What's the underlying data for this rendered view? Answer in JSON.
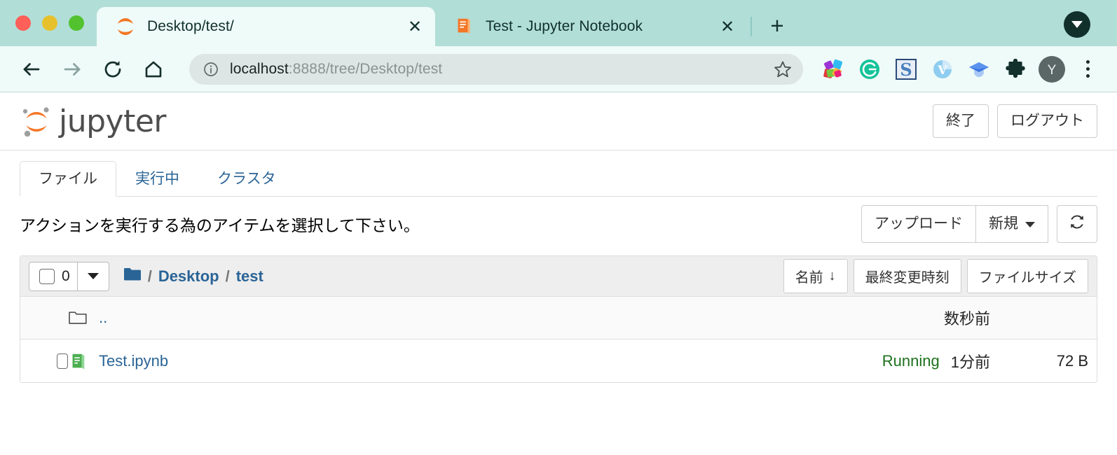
{
  "browser": {
    "tabs": [
      {
        "title": "Desktop/test/",
        "favicon": "jupyter-loading-icon",
        "active": true,
        "close_label": "✕"
      },
      {
        "title": "Test - Jupyter Notebook",
        "favicon": "notebook-orange-icon",
        "active": false,
        "close_label": "✕"
      }
    ],
    "new_tab_label": "+",
    "nav": {
      "back": "back-arrow-icon",
      "forward": "forward-arrow-icon",
      "reload": "reload-icon",
      "home": "home-icon"
    },
    "omnibox": {
      "info_icon": "info-circle-icon",
      "url_host": "localhost",
      "url_rest": ":8888/tree/Desktop/test",
      "url_full": "localhost:8888/tree/Desktop/test",
      "bookmark_icon": "star-outline-icon"
    },
    "extensions": [
      "colorful-pinwheel-extension-icon",
      "grammarly-extension-icon",
      "s-blue-extension-icon",
      "v-blue-extension-icon",
      "graduation-cap-extension-icon",
      "puzzle-extensions-icon"
    ],
    "profile_initial": "Y",
    "menu_icon": "kebab-menu-icon",
    "tab_search_icon": "tab-search-caret-icon"
  },
  "jupyter": {
    "logo_text": "jupyter",
    "header_buttons": [
      {
        "label": "終了",
        "name": "quit-button"
      },
      {
        "label": "ログアウト",
        "name": "logout-button"
      }
    ],
    "tabs": [
      {
        "label": "ファイル",
        "active": true
      },
      {
        "label": "実行中",
        "active": false
      },
      {
        "label": "クラスタ",
        "active": false
      }
    ],
    "action_text": "アクションを実行する為のアイテムを選択して下さい。",
    "upload_label": "アップロード",
    "new_label": "新規",
    "refresh_icon": "refresh-icon",
    "selection": {
      "count": "0",
      "checkbox_icon": "checkbox-unchecked-icon",
      "caret_icon": "chevron-down-icon"
    },
    "breadcrumb": {
      "folder_icon": "folder-blue-icon",
      "sep": "/",
      "items": [
        "Desktop",
        "test"
      ]
    },
    "sort_buttons": [
      {
        "label": "名前",
        "arrow": "↓",
        "name": "sort-name-button"
      },
      {
        "label": "最終変更時刻",
        "arrow": "",
        "name": "sort-modified-button"
      },
      {
        "label": "ファイルサイズ",
        "arrow": "",
        "name": "sort-size-button"
      }
    ],
    "files": [
      {
        "name": "..",
        "icon": "folder-outline-icon",
        "has_checkbox": false,
        "status": "",
        "modified": "数秒前",
        "size": ""
      },
      {
        "name": "Test.ipynb",
        "icon": "notebook-green-icon",
        "has_checkbox": true,
        "status": "Running",
        "modified": "1分前",
        "size": "72 B"
      }
    ]
  },
  "colors": {
    "tabstrip": "#b2ded8",
    "active_tab": "#effbf8",
    "jupyter_orange": "#f37726",
    "link_blue": "#2a6496",
    "running_green": "#1c711c",
    "notebook_green": "#4caf50"
  }
}
